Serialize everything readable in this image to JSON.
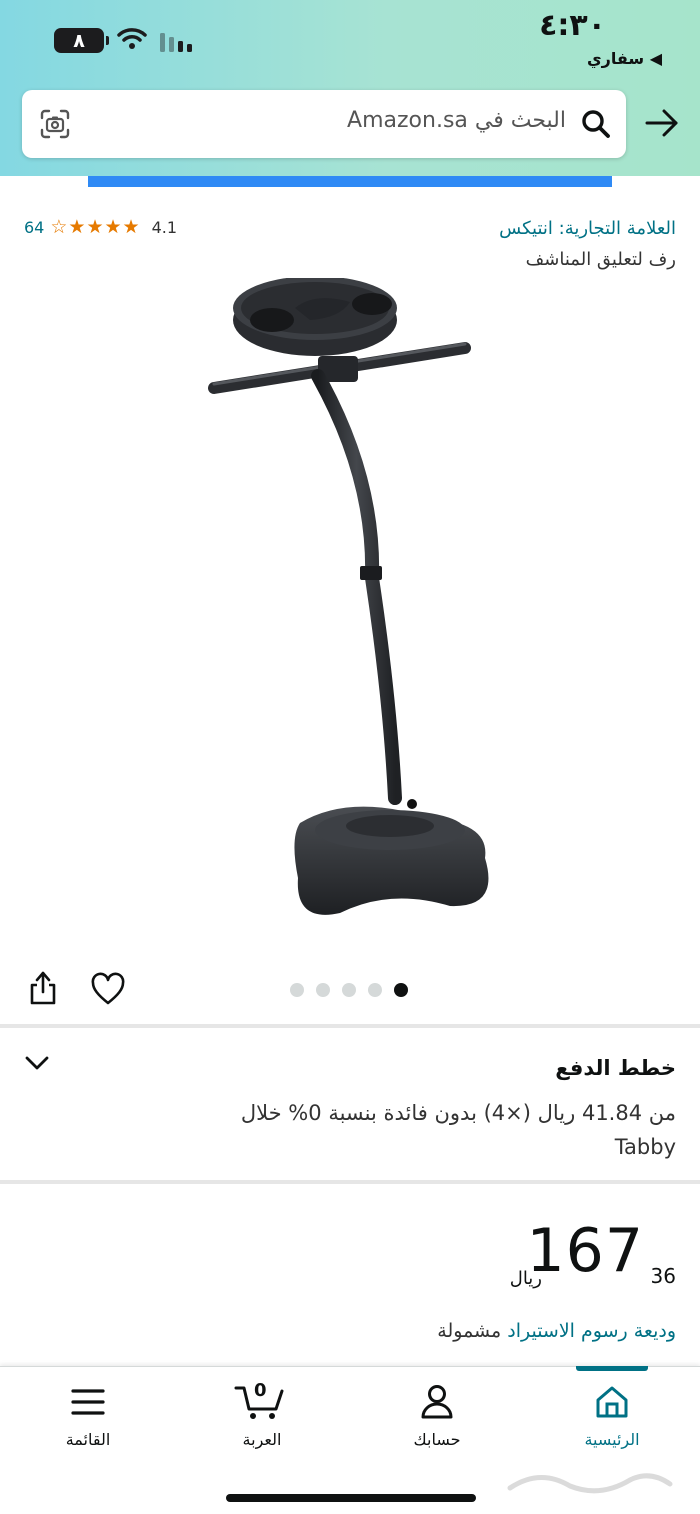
{
  "status_bar": {
    "time": "٤:٣٠",
    "back_app": "◀ سفاري",
    "battery_level": "٨"
  },
  "search": {
    "placeholder": "البحث في Amazon.sa"
  },
  "product": {
    "brand": "العلامة التجارية: انتيكس",
    "subtitle": "رف لتعليق المناشف",
    "rating_value": "4.1",
    "rating_stars": 4.1,
    "rating_count": "64",
    "image_count": 5,
    "active_image_index": 4
  },
  "payment_plans": {
    "title": "خطط الدفع",
    "text": "من 41.84 ريال (×4) بدون فائدة بنسبة 0% خلال Tabby"
  },
  "price": {
    "whole": "167",
    "fraction": "36",
    "currency": "ريال"
  },
  "deposit": {
    "link": "وديعة رسوم الاستيراد",
    "rest": " مشمولة"
  },
  "bottom_nav": {
    "home": "الرئيسية",
    "account": "حسابك",
    "cart": "العربة",
    "cart_count": "0",
    "menu": "القائمة",
    "active": "home"
  },
  "colors": {
    "link": "#007185",
    "star": "#e67a00",
    "header_gradient_start": "#84d8e2",
    "header_gradient_end": "#a6e4cb",
    "progress": "#2f8af5"
  }
}
